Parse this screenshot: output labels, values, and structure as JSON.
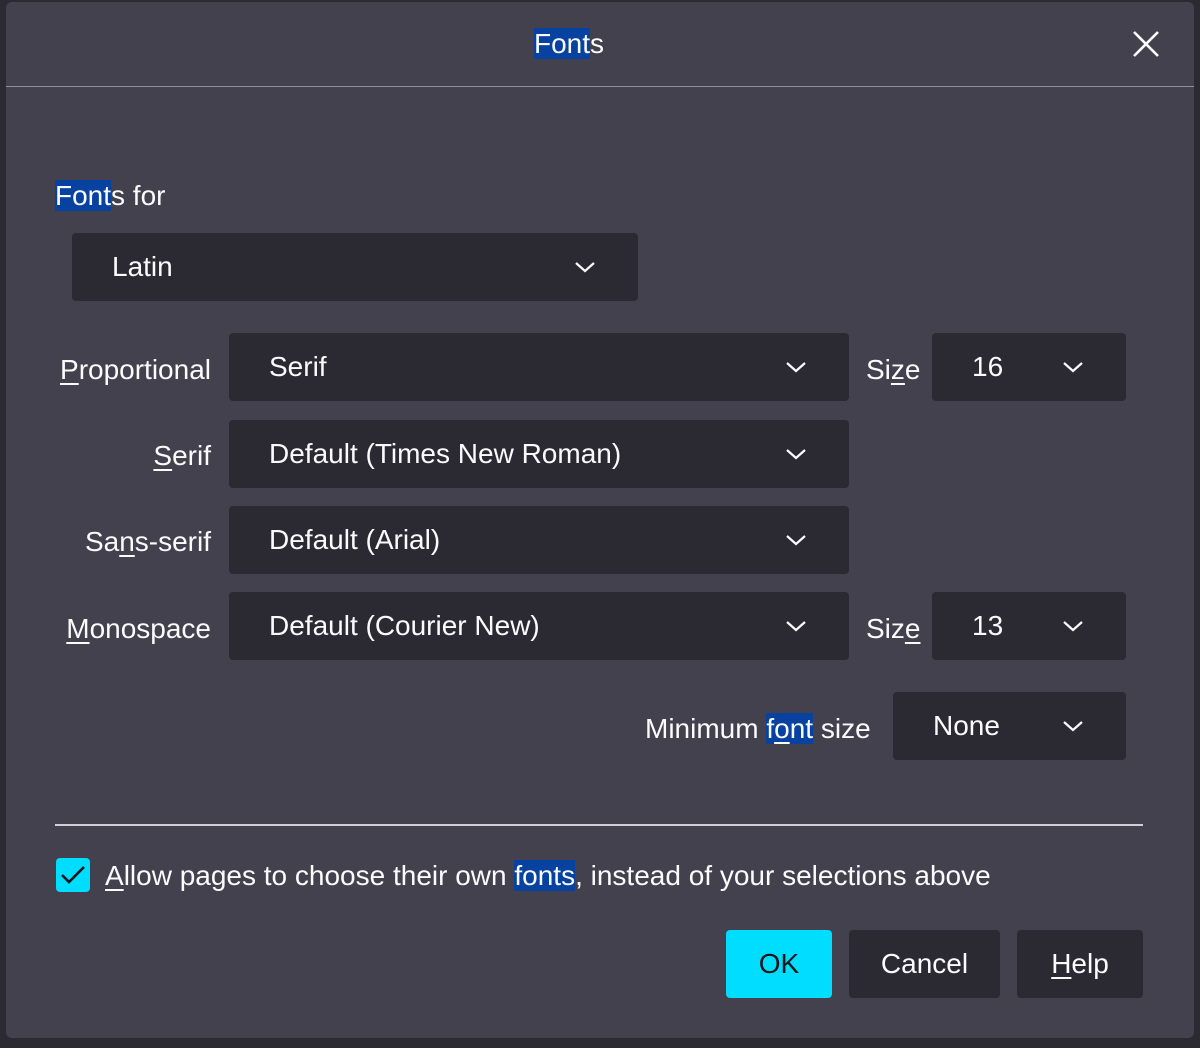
{
  "dialog": {
    "title_hl": "Font",
    "title_rest": "s"
  },
  "fonts_for": {
    "label_hl": "Font",
    "label_rest": "s for",
    "value": "Latin"
  },
  "proportional": {
    "label_u": "P",
    "label_rest": "roportional",
    "value": "Serif",
    "size_label_a": "Si",
    "size_label_u": "z",
    "size_label_b": "e",
    "size_value": "16"
  },
  "serif": {
    "label_u": "S",
    "label_rest": "erif",
    "value": "Default (Times New Roman)"
  },
  "sans_serif": {
    "label_a": "Sa",
    "label_u": "n",
    "label_b": "s-serif",
    "value": "Default (Arial)"
  },
  "monospace": {
    "label_u": "M",
    "label_rest": "onospace",
    "value": "Default (Courier New)",
    "size_label_a": "Siz",
    "size_label_u": "e",
    "size_value": "13"
  },
  "minimum": {
    "label_a": "Minimum ",
    "label_hl_a": "f",
    "label_hl_u": "o",
    "label_hl_b": "nt",
    "label_b": " size",
    "value": "None"
  },
  "allow": {
    "checked": true,
    "label_u": "A",
    "label_a": "llow pages to choose their own ",
    "label_hl": "fonts",
    "label_b": ", instead of your selections above"
  },
  "buttons": {
    "ok": "OK",
    "cancel": "Cancel",
    "help_u": "H",
    "help_rest": "elp"
  },
  "colors": {
    "dialog_bg": "#42414d",
    "field_bg": "#2b2a33",
    "accent": "#00ddff",
    "highlight": "#0842a0"
  },
  "icons": [
    "close-icon",
    "chevron-down-icon",
    "checkmark-icon"
  ]
}
